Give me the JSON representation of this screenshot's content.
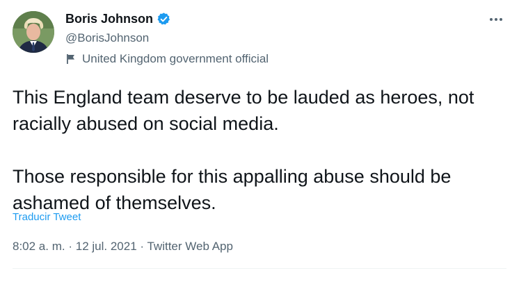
{
  "author": {
    "name": "Boris Johnson",
    "handle": "@BorisJohnson",
    "label": "United Kingdom government official",
    "verified": true
  },
  "tweet": {
    "paragraphs": [
      "This England team deserve to be lauded as heroes, not racially abused on social media.",
      "Those responsible for this appalling abuse should be ashamed of themselves."
    ],
    "translate_label": "Traducir Tweet",
    "time": "8:02 a. m.",
    "separator": "·",
    "date": "12 jul. 2021",
    "source": "Twitter Web App"
  },
  "colors": {
    "accent": "#1d9bf0",
    "text": "#0f1419",
    "secondary": "#536471"
  },
  "icons": {
    "verified": "verified-badge-icon",
    "label": "flag-icon",
    "menu": "more-options-icon"
  }
}
